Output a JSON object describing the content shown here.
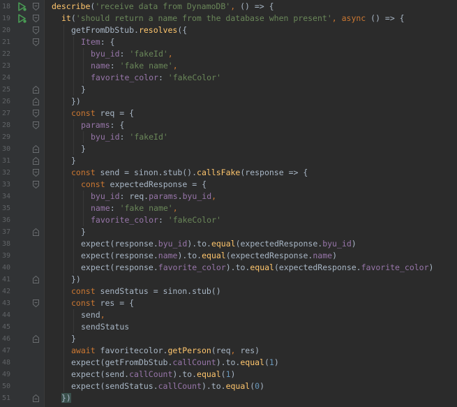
{
  "editor": {
    "colors": {
      "background": "#2b2b2b",
      "gutter": "#313335",
      "line_number": "#606366",
      "keyword": "#cc7832",
      "string": "#6a8759",
      "function": "#ffc66d",
      "property": "#9876aa",
      "number": "#6897bb",
      "plain": "#a9b7c6",
      "run_icon": "#499c54"
    },
    "lines": [
      {
        "num": "18",
        "run": true,
        "fold": "open",
        "indent": 0,
        "tokens": [
          [
            "fn",
            "describe"
          ],
          [
            "plain",
            "("
          ],
          [
            "str",
            "'receive data from DynamoDB'"
          ],
          [
            "kw",
            ", "
          ],
          [
            "plain",
            "() => {"
          ]
        ]
      },
      {
        "num": "19",
        "run": true,
        "fold": "open",
        "indent": 1,
        "tokens": [
          [
            "fn",
            "it"
          ],
          [
            "plain",
            "("
          ],
          [
            "str",
            "'should return a name from the database when present'"
          ],
          [
            "kw",
            ", async "
          ],
          [
            "plain",
            "() => {"
          ]
        ]
      },
      {
        "num": "20",
        "run": false,
        "fold": "open",
        "indent": 2,
        "tokens": [
          [
            "plain",
            "getFromDbStub."
          ],
          [
            "fn",
            "resolves"
          ],
          [
            "plain",
            "({"
          ]
        ]
      },
      {
        "num": "21",
        "run": false,
        "fold": "open",
        "indent": 3,
        "tokens": [
          [
            "prop",
            "Item"
          ],
          [
            "plain",
            ": {"
          ]
        ]
      },
      {
        "num": "22",
        "run": false,
        "fold": "",
        "indent": 4,
        "tokens": [
          [
            "prop",
            "byu_id"
          ],
          [
            "plain",
            ": "
          ],
          [
            "str",
            "'fakeId'"
          ],
          [
            "kw",
            ","
          ]
        ]
      },
      {
        "num": "23",
        "run": false,
        "fold": "",
        "indent": 4,
        "tokens": [
          [
            "prop",
            "name"
          ],
          [
            "plain",
            ": "
          ],
          [
            "str",
            "'fake name'"
          ],
          [
            "kw",
            ","
          ]
        ]
      },
      {
        "num": "24",
        "run": false,
        "fold": "",
        "indent": 4,
        "tokens": [
          [
            "prop",
            "favorite_color"
          ],
          [
            "plain",
            ": "
          ],
          [
            "str",
            "'fakeColor'"
          ]
        ]
      },
      {
        "num": "25",
        "run": false,
        "fold": "close",
        "indent": 3,
        "tokens": [
          [
            "plain",
            "}"
          ]
        ]
      },
      {
        "num": "26",
        "run": false,
        "fold": "close",
        "indent": 2,
        "tokens": [
          [
            "plain",
            "})"
          ]
        ]
      },
      {
        "num": "27",
        "run": false,
        "fold": "open",
        "indent": 2,
        "tokens": [
          [
            "kw",
            "const "
          ],
          [
            "plain",
            "req = {"
          ]
        ]
      },
      {
        "num": "28",
        "run": false,
        "fold": "open",
        "indent": 3,
        "tokens": [
          [
            "prop",
            "params"
          ],
          [
            "plain",
            ": {"
          ]
        ]
      },
      {
        "num": "29",
        "run": false,
        "fold": "",
        "indent": 4,
        "tokens": [
          [
            "prop",
            "byu_id"
          ],
          [
            "plain",
            ": "
          ],
          [
            "str",
            "'fakeId'"
          ]
        ]
      },
      {
        "num": "30",
        "run": false,
        "fold": "close",
        "indent": 3,
        "tokens": [
          [
            "plain",
            "}"
          ]
        ]
      },
      {
        "num": "31",
        "run": false,
        "fold": "close",
        "indent": 2,
        "tokens": [
          [
            "plain",
            "}"
          ]
        ]
      },
      {
        "num": "32",
        "run": false,
        "fold": "open",
        "indent": 2,
        "tokens": [
          [
            "kw",
            "const "
          ],
          [
            "plain",
            "send = sinon.stub()."
          ],
          [
            "fn",
            "callsFake"
          ],
          [
            "plain",
            "(response => {"
          ]
        ]
      },
      {
        "num": "33",
        "run": false,
        "fold": "open",
        "indent": 3,
        "tokens": [
          [
            "kw",
            "const "
          ],
          [
            "plain",
            "expectedResponse = {"
          ]
        ]
      },
      {
        "num": "34",
        "run": false,
        "fold": "",
        "indent": 4,
        "tokens": [
          [
            "prop",
            "byu_id"
          ],
          [
            "plain",
            ": req."
          ],
          [
            "prop",
            "params"
          ],
          [
            "plain",
            "."
          ],
          [
            "prop",
            "byu_id"
          ],
          [
            "kw",
            ","
          ]
        ]
      },
      {
        "num": "35",
        "run": false,
        "fold": "",
        "indent": 4,
        "tokens": [
          [
            "prop",
            "name"
          ],
          [
            "plain",
            ": "
          ],
          [
            "str",
            "'fake name'"
          ],
          [
            "kw",
            ","
          ]
        ]
      },
      {
        "num": "36",
        "run": false,
        "fold": "",
        "indent": 4,
        "tokens": [
          [
            "prop",
            "favorite_color"
          ],
          [
            "plain",
            ": "
          ],
          [
            "str",
            "'fakeColor'"
          ]
        ]
      },
      {
        "num": "37",
        "run": false,
        "fold": "close",
        "indent": 3,
        "tokens": [
          [
            "plain",
            "}"
          ]
        ]
      },
      {
        "num": "38",
        "run": false,
        "fold": "",
        "indent": 3,
        "tokens": [
          [
            "plain",
            "expect(response."
          ],
          [
            "prop",
            "byu_id"
          ],
          [
            "plain",
            ").to."
          ],
          [
            "fn",
            "equal"
          ],
          [
            "plain",
            "(expectedResponse."
          ],
          [
            "prop",
            "byu_id"
          ],
          [
            "plain",
            ")"
          ]
        ]
      },
      {
        "num": "39",
        "run": false,
        "fold": "",
        "indent": 3,
        "tokens": [
          [
            "plain",
            "expect(response."
          ],
          [
            "prop",
            "name"
          ],
          [
            "plain",
            ").to."
          ],
          [
            "fn",
            "equal"
          ],
          [
            "plain",
            "(expectedResponse."
          ],
          [
            "prop",
            "name"
          ],
          [
            "plain",
            ")"
          ]
        ]
      },
      {
        "num": "40",
        "run": false,
        "fold": "",
        "indent": 3,
        "tokens": [
          [
            "plain",
            "expect(response."
          ],
          [
            "prop",
            "favorite_color"
          ],
          [
            "plain",
            ").to."
          ],
          [
            "fn",
            "equal"
          ],
          [
            "plain",
            "(expectedResponse."
          ],
          [
            "prop",
            "favorite_color"
          ],
          [
            "plain",
            ")"
          ]
        ]
      },
      {
        "num": "41",
        "run": false,
        "fold": "close",
        "indent": 2,
        "tokens": [
          [
            "plain",
            "})"
          ]
        ]
      },
      {
        "num": "42",
        "run": false,
        "fold": "",
        "indent": 2,
        "tokens": [
          [
            "kw",
            "const "
          ],
          [
            "plain",
            "sendStatus = sinon.stub()"
          ]
        ]
      },
      {
        "num": "43",
        "run": false,
        "fold": "open",
        "indent": 2,
        "tokens": [
          [
            "kw",
            "const "
          ],
          [
            "plain",
            "res = {"
          ]
        ]
      },
      {
        "num": "44",
        "run": false,
        "fold": "",
        "indent": 3,
        "tokens": [
          [
            "plain",
            "send"
          ],
          [
            "kw",
            ","
          ]
        ]
      },
      {
        "num": "45",
        "run": false,
        "fold": "",
        "indent": 3,
        "tokens": [
          [
            "plain",
            "sendStatus"
          ]
        ]
      },
      {
        "num": "46",
        "run": false,
        "fold": "close",
        "indent": 2,
        "tokens": [
          [
            "plain",
            "}"
          ]
        ]
      },
      {
        "num": "47",
        "run": false,
        "fold": "",
        "indent": 2,
        "tokens": [
          [
            "kw",
            "await "
          ],
          [
            "plain",
            "favoritecolor."
          ],
          [
            "fn",
            "getPerson"
          ],
          [
            "plain",
            "(req"
          ],
          [
            "kw",
            ", "
          ],
          [
            "plain",
            "res)"
          ]
        ]
      },
      {
        "num": "48",
        "run": false,
        "fold": "",
        "indent": 2,
        "tokens": [
          [
            "plain",
            "expect(getFromDbStub."
          ],
          [
            "prop",
            "callCount"
          ],
          [
            "plain",
            ").to."
          ],
          [
            "fn",
            "equal"
          ],
          [
            "plain",
            "("
          ],
          [
            "num",
            "1"
          ],
          [
            "plain",
            ")"
          ]
        ]
      },
      {
        "num": "49",
        "run": false,
        "fold": "",
        "indent": 2,
        "tokens": [
          [
            "plain",
            "expect(send."
          ],
          [
            "prop",
            "callCount"
          ],
          [
            "plain",
            ").to."
          ],
          [
            "fn",
            "equal"
          ],
          [
            "plain",
            "("
          ],
          [
            "num",
            "1"
          ],
          [
            "plain",
            ")"
          ]
        ]
      },
      {
        "num": "50",
        "run": false,
        "fold": "",
        "indent": 2,
        "tokens": [
          [
            "plain",
            "expect(sendStatus."
          ],
          [
            "prop",
            "callCount"
          ],
          [
            "plain",
            ").to."
          ],
          [
            "fn",
            "equal"
          ],
          [
            "plain",
            "("
          ],
          [
            "num",
            "0"
          ],
          [
            "plain",
            ")"
          ]
        ]
      },
      {
        "num": "51",
        "run": false,
        "fold": "close",
        "indent": 1,
        "tokens": [
          [
            "bracket-hl",
            "})"
          ]
        ]
      }
    ]
  }
}
